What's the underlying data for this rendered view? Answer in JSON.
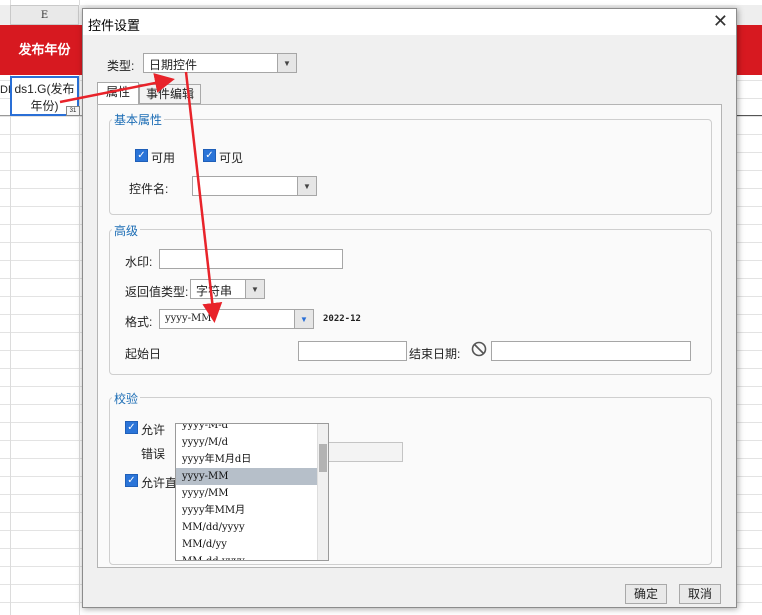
{
  "sheet": {
    "column_letter": "E",
    "header_cell": "发布年份",
    "selected_cell": [
      "ds1.G(发布",
      "年份)"
    ],
    "left_fragment": "DL",
    "cell_badge": "31"
  },
  "dialog": {
    "title": "控件设置",
    "close_icon": "close-icon",
    "type_label": "类型:",
    "type_value": "日期控件",
    "tabs": [
      {
        "label": "属性",
        "active": true
      },
      {
        "label": "事件编辑",
        "active": false
      }
    ],
    "basic": {
      "title": "基本属性",
      "enabled_label": "可用",
      "visible_label": "可见",
      "name_label": "控件名:",
      "name_value": ""
    },
    "advanced": {
      "title": "高级",
      "watermark_label": "水印:",
      "return_type_label": "返回值类型:",
      "return_type_value": "字符串",
      "format_label": "格式:",
      "format_value": "yyyy-MM",
      "format_preview": "2022-12",
      "start_date_label": "起始日",
      "end_date_label": "结束日期:",
      "format_options": [
        "yyyy-M-d",
        "yyyy/M/d",
        "yyyy年M月d日",
        "yyyy-MM",
        "yyyy/MM",
        "yyyy年MM月",
        "MM/dd/yyyy",
        "MM/d/yy",
        "MM-dd-yyyy"
      ],
      "format_selected": "yyyy-MM"
    },
    "validation": {
      "title": "校验",
      "allow_empty_label": "允许",
      "error_label": "错误",
      "direct_edit_label": "允许直接编辑"
    },
    "ok_label": "确定",
    "cancel_label": "取消"
  },
  "colors": {
    "header_red": "#d71920",
    "arrow_red": "#e8232a",
    "selection_blue": "#2a6fd6",
    "checkbox_blue": "#2a74d8",
    "group_title_blue": "#1c6db5"
  }
}
